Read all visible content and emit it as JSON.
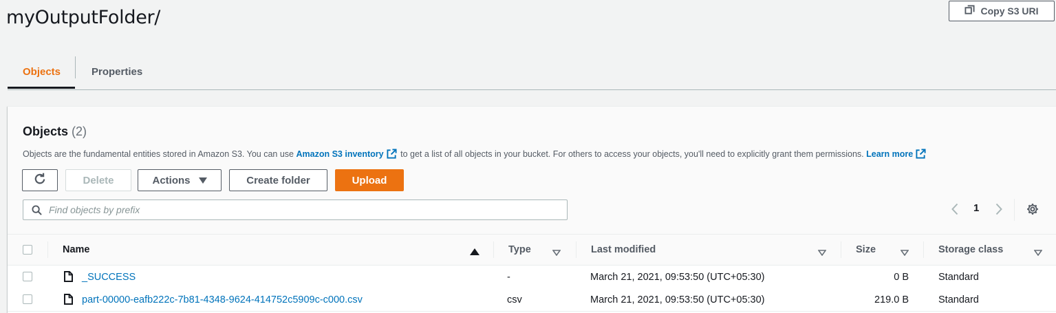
{
  "page": {
    "title": "myOutputFolder/",
    "copy_uri_label": "Copy S3 URI"
  },
  "tabs": [
    {
      "label": "Objects",
      "active": true
    },
    {
      "label": "Properties",
      "active": false
    }
  ],
  "objects_panel": {
    "heading": "Objects",
    "count": "(2)",
    "description_before": "Objects are the fundamental entities stored in Amazon S3. You can use",
    "inventory_link": "Amazon S3 inventory",
    "description_middle": "to get a list of all objects in your bucket. For others to access your objects, you'll need to explicitly grant them permissions.",
    "learn_more_link": "Learn more"
  },
  "toolbar": {
    "refresh_icon": "refresh-icon",
    "delete_label": "Delete",
    "actions_label": "Actions",
    "create_folder_label": "Create folder",
    "upload_label": "Upload"
  },
  "search": {
    "placeholder": "Find objects by prefix",
    "value": ""
  },
  "pagination": {
    "current_page": "1"
  },
  "table": {
    "columns": [
      "Name",
      "Type",
      "Last modified",
      "Size",
      "Storage class"
    ],
    "rows": [
      {
        "name": "_SUCCESS",
        "type": "-",
        "last_modified": "March 21, 2021, 09:53:50 (UTC+05:30)",
        "size": "0 B",
        "storage_class": "Standard"
      },
      {
        "name": "part-00000-eafb222c-7b81-4348-9624-414752c5909c-c000.csv",
        "type": "csv",
        "last_modified": "March 21, 2021, 09:53:50 (UTC+05:30)",
        "size": "219.0 B",
        "storage_class": "Standard"
      }
    ]
  },
  "colors": {
    "accent_orange": "#ec7211",
    "link_blue": "#0073bb",
    "text_dark": "#16191f",
    "text_secondary": "#545b64"
  }
}
